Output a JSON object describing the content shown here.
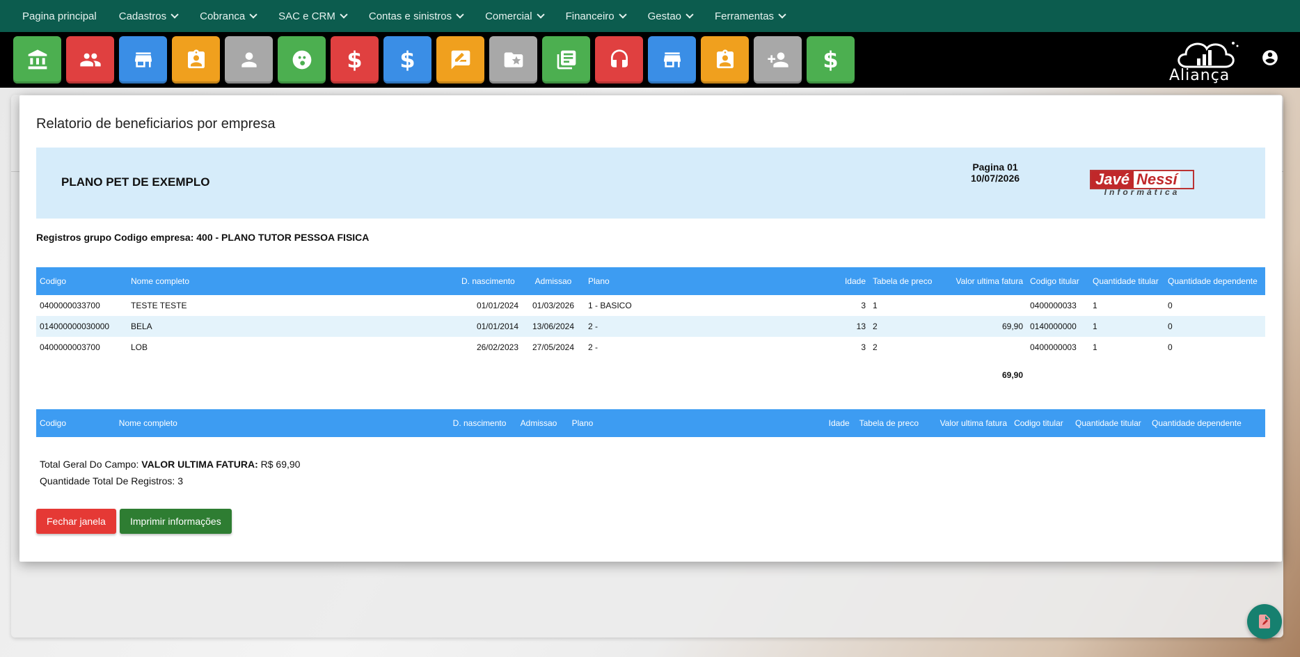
{
  "nav": {
    "items": [
      {
        "label": "Pagina principal",
        "has_dropdown": false
      },
      {
        "label": "Cadastros",
        "has_dropdown": true
      },
      {
        "label": "Cobranca",
        "has_dropdown": true
      },
      {
        "label": "SAC e CRM",
        "has_dropdown": true
      },
      {
        "label": "Contas e sinistros",
        "has_dropdown": true
      },
      {
        "label": "Comercial",
        "has_dropdown": true
      },
      {
        "label": "Financeiro",
        "has_dropdown": true
      },
      {
        "label": "Gestao",
        "has_dropdown": true
      },
      {
        "label": "Ferramentas",
        "has_dropdown": true
      }
    ]
  },
  "toolbar": {
    "tiles": [
      {
        "icon": "bank-icon",
        "color": "#4caf50"
      },
      {
        "icon": "people-icon",
        "color": "#e04040"
      },
      {
        "icon": "store-icon",
        "color": "#3a8ee6"
      },
      {
        "icon": "badge-icon",
        "color": "#f0a01e"
      },
      {
        "icon": "person-icon",
        "color": "#a8a8a8"
      },
      {
        "icon": "paw-icon",
        "color": "#4caf50"
      },
      {
        "icon": "dollar-icon",
        "color": "#e04040"
      },
      {
        "icon": "dollar-icon",
        "color": "#3a8ee6"
      },
      {
        "icon": "rate-review-icon",
        "color": "#f0a01e"
      },
      {
        "icon": "folder-star-icon",
        "color": "#a8a8a8"
      },
      {
        "icon": "library-books-icon",
        "color": "#4caf50"
      },
      {
        "icon": "headset-icon",
        "color": "#e04040"
      },
      {
        "icon": "store-icon",
        "color": "#3a8ee6"
      },
      {
        "icon": "badge-icon",
        "color": "#f0a01e"
      },
      {
        "icon": "person-add-icon",
        "color": "#a8a8a8"
      },
      {
        "icon": "dollar-icon",
        "color": "#4caf50"
      }
    ]
  },
  "brand": {
    "name": "Aliança"
  },
  "modal": {
    "title": "Relatorio de beneficiarios por empresa",
    "report": {
      "plan_name": "PLANO PET DE EXEMPLO",
      "page": "Pagina 01",
      "date": "10/07/2026",
      "logo": {
        "part1": "Javé",
        "part2": "Nessí",
        "sub": "Informática"
      }
    },
    "group_line": "Registros grupo Codigo empresa: 400 - PLANO TUTOR PESSOA FISICA",
    "columns": [
      "Codigo",
      "Nome completo",
      "D. nascimento",
      "Admissao",
      "Plano",
      "Idade",
      "Tabela de preco",
      "Valor ultima fatura",
      "Codigo titular",
      "Quantidade titular",
      "Quantidade dependente"
    ],
    "rows": [
      {
        "codigo": "0400000033700",
        "nome": "TESTE TESTE",
        "nascimento": "01/01/2024",
        "admissao": "01/03/2026",
        "plano": "1 - BASICO",
        "idade": "3",
        "tabela": "1",
        "valor": "",
        "titular": "0400000033",
        "qtd_titular": "1",
        "qtd_dependente": "0"
      },
      {
        "codigo": "014000000030000",
        "nome": "BELA",
        "nascimento": "01/01/2014",
        "admissao": "13/06/2024",
        "plano": "2 -",
        "idade": "13",
        "tabela": "2",
        "valor": "69,90",
        "titular": "0140000000",
        "qtd_titular": "1",
        "qtd_dependente": "0"
      },
      {
        "codigo": "0400000003700",
        "nome": "LOB",
        "nascimento": "26/02/2023",
        "admissao": "27/05/2024",
        "plano": "2 -",
        "idade": "3",
        "tabela": "2",
        "valor": "",
        "titular": "0400000003",
        "qtd_titular": "1",
        "qtd_dependente": "0"
      }
    ],
    "total_value": "69,90",
    "summary": {
      "total_label": "Total Geral Do Campo:",
      "total_field": "VALOR ULTIMA FATURA:",
      "total_amount": "R$ 69,90",
      "count_label": "Quantidade Total De Registros:",
      "count_value": "3"
    },
    "buttons": {
      "close": "Fechar janela",
      "print": "Imprimir informações"
    }
  },
  "colors": {
    "nav_bg": "#0c5c4e",
    "table_header": "#3d9cf2",
    "report_header_bg": "#d6ecfa",
    "close_button": "#e53935",
    "print_button": "#2e7d32"
  }
}
